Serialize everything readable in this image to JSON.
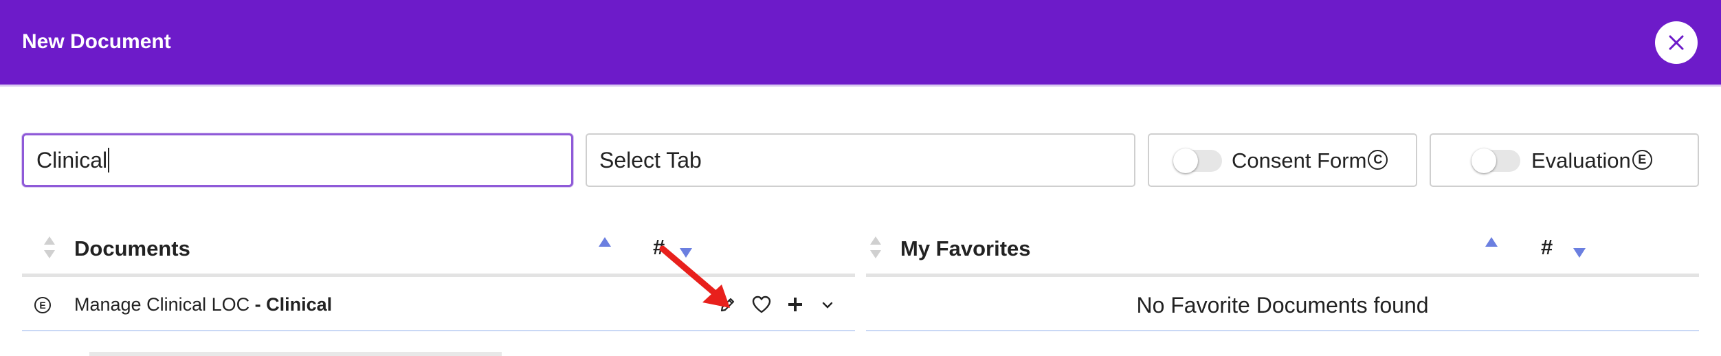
{
  "modal": {
    "title": "New Document",
    "close_icon": "close-icon",
    "accent_color": "#6d1bc9"
  },
  "filters": {
    "search_value": "Clinical",
    "tab_select_label": "Select Tab",
    "consent_form_label": "Consent Form",
    "consent_form_badge": "C",
    "consent_form_on": false,
    "evaluation_label": "Evaluation",
    "evaluation_badge": "E",
    "evaluation_on": false
  },
  "documents_table": {
    "header": "Documents",
    "count_header": "#",
    "rows": [
      {
        "type_badge": "E",
        "name": "Manage Clinical LOC",
        "separator": " - ",
        "tab": "Clinical",
        "actions": [
          "pencil-icon",
          "heart-icon",
          "plus-icon",
          "chevron-down-icon"
        ]
      }
    ]
  },
  "favorites_table": {
    "header": "My Favorites",
    "count_header": "#",
    "empty_message": "No Favorite Documents found"
  },
  "colors": {
    "sort_active": "#6b7fe0",
    "sort_inactive": "#d0d0d0",
    "annotation_arrow": "#e8201c"
  }
}
